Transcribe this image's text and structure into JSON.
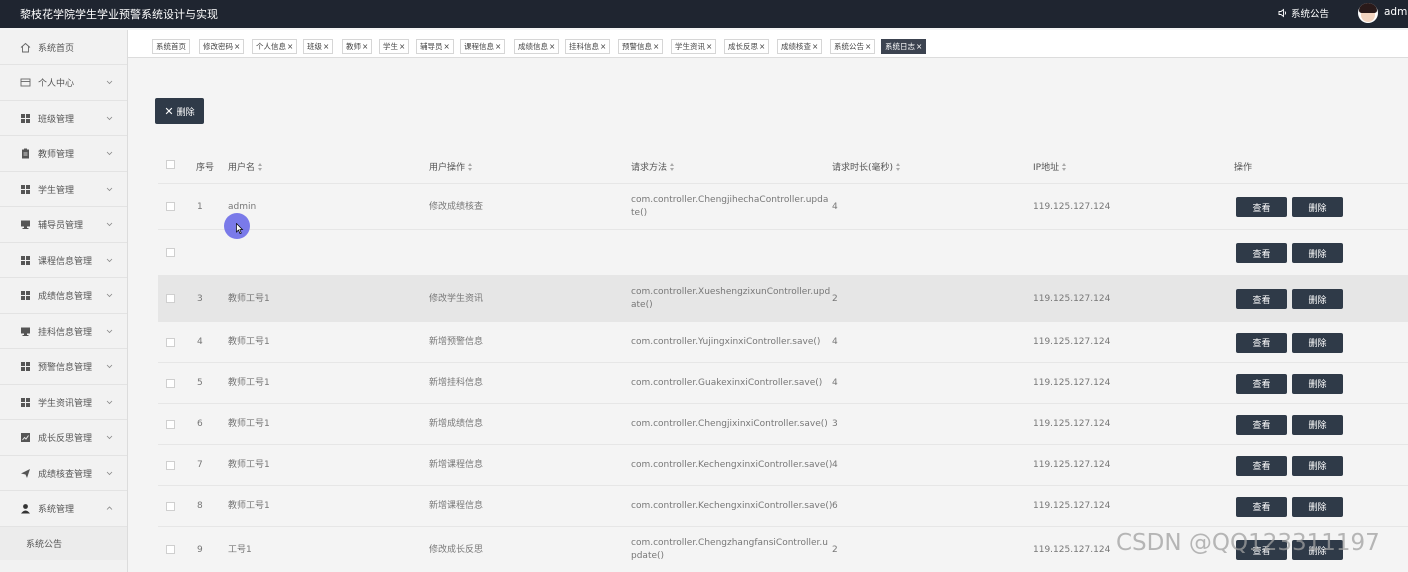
{
  "header": {
    "app_title": "黎枝花学院学生学业预警系统设计与实现",
    "notice_label": "系统公告",
    "username": "admin"
  },
  "sidebar": {
    "items": [
      {
        "label": "系统首页",
        "icon": "home-icon",
        "expandable": false
      },
      {
        "label": "个人中心",
        "icon": "id-card-icon",
        "expandable": true
      },
      {
        "label": "班级管理",
        "icon": "grid-icon",
        "expandable": true
      },
      {
        "label": "教师管理",
        "icon": "clipboard-icon",
        "expandable": true
      },
      {
        "label": "学生管理",
        "icon": "grid-icon",
        "expandable": true
      },
      {
        "label": "辅导员管理",
        "icon": "monitor-icon",
        "expandable": true
      },
      {
        "label": "课程信息管理",
        "icon": "grid-icon",
        "expandable": true
      },
      {
        "label": "成绩信息管理",
        "icon": "grid-icon",
        "expandable": true
      },
      {
        "label": "挂科信息管理",
        "icon": "monitor-icon",
        "expandable": true
      },
      {
        "label": "预警信息管理",
        "icon": "grid-icon",
        "expandable": true
      },
      {
        "label": "学生资讯管理",
        "icon": "grid-icon",
        "expandable": true
      },
      {
        "label": "成长反思管理",
        "icon": "chart-icon",
        "expandable": true
      },
      {
        "label": "成绩核查管理",
        "icon": "send-icon",
        "expandable": true
      },
      {
        "label": "系统管理",
        "icon": "user-icon",
        "expandable": true,
        "expanded": true
      }
    ],
    "sub_items": [
      {
        "label": "系统公告"
      }
    ]
  },
  "tabs": [
    {
      "label": "系统首页",
      "closable": false
    },
    {
      "label": "修改密码",
      "closable": true
    },
    {
      "label": "个人信息",
      "closable": true
    },
    {
      "label": "班级",
      "closable": true
    },
    {
      "label": "教师",
      "closable": true
    },
    {
      "label": "学生",
      "closable": true
    },
    {
      "label": "辅导员",
      "closable": true
    },
    {
      "label": "课程信息",
      "closable": true
    },
    {
      "label": "成绩信息",
      "closable": true
    },
    {
      "label": "挂科信息",
      "closable": true
    },
    {
      "label": "预警信息",
      "closable": true
    },
    {
      "label": "学生资讯",
      "closable": true
    },
    {
      "label": "成长反思",
      "closable": true
    },
    {
      "label": "成绩核查",
      "closable": true
    },
    {
      "label": "系统公告",
      "closable": true
    },
    {
      "label": "系统日志",
      "closable": true,
      "active": true
    }
  ],
  "toolbar": {
    "delete_label": "删除"
  },
  "table": {
    "columns": [
      "序号",
      "用户名",
      "用户操作",
      "请求方法",
      "请求时长(毫秒)",
      "IP地址",
      "操作"
    ],
    "rows": [
      {
        "index": "1",
        "username": "admin",
        "operation": "修改成绩核查",
        "method": [
          "com.controller.ChengjihechaController.upda",
          "te()"
        ],
        "duration": "4",
        "ip": "119.125.127.124"
      },
      {
        "index": "",
        "username": "",
        "operation": "",
        "method": [],
        "duration": "",
        "ip": ""
      },
      {
        "index": "3",
        "username": "教师工号1",
        "operation": "修改学生资讯",
        "method": [
          "com.controller.XueshengzixunController.upd",
          "ate()"
        ],
        "duration": "2",
        "ip": "119.125.127.124"
      },
      {
        "index": "4",
        "username": "教师工号1",
        "operation": "新增预警信息",
        "method": [
          "com.controller.YujingxinxiController.save()"
        ],
        "duration": "4",
        "ip": "119.125.127.124"
      },
      {
        "index": "5",
        "username": "教师工号1",
        "operation": "新增挂科信息",
        "method": [
          "com.controller.GuakexinxiController.save()"
        ],
        "duration": "4",
        "ip": "119.125.127.124"
      },
      {
        "index": "6",
        "username": "教师工号1",
        "operation": "新增成绩信息",
        "method": [
          "com.controller.ChengjixinxiController.save()"
        ],
        "duration": "3",
        "ip": "119.125.127.124"
      },
      {
        "index": "7",
        "username": "教师工号1",
        "operation": "新增课程信息",
        "method": [
          "com.controller.KechengxinxiController.save()"
        ],
        "duration": "4",
        "ip": "119.125.127.124"
      },
      {
        "index": "8",
        "username": "教师工号1",
        "operation": "新增课程信息",
        "method": [
          "com.controller.KechengxinxiController.save()"
        ],
        "duration": "6",
        "ip": "119.125.127.124"
      },
      {
        "index": "9",
        "username": "工号1",
        "operation": "修改成长反思",
        "method": [
          "com.controller.ChengzhangfansiController.u",
          "pdate()"
        ],
        "duration": "2",
        "ip": "119.125.127.124"
      }
    ],
    "view_label": "查看",
    "delete_label": "删除"
  },
  "watermark": "CSDN @QQ123311197",
  "colors": {
    "topbar": "#1f2530",
    "button": "#2f3a48",
    "active_tab": "#3c4350",
    "highlight_row": "#e6e6e6"
  }
}
